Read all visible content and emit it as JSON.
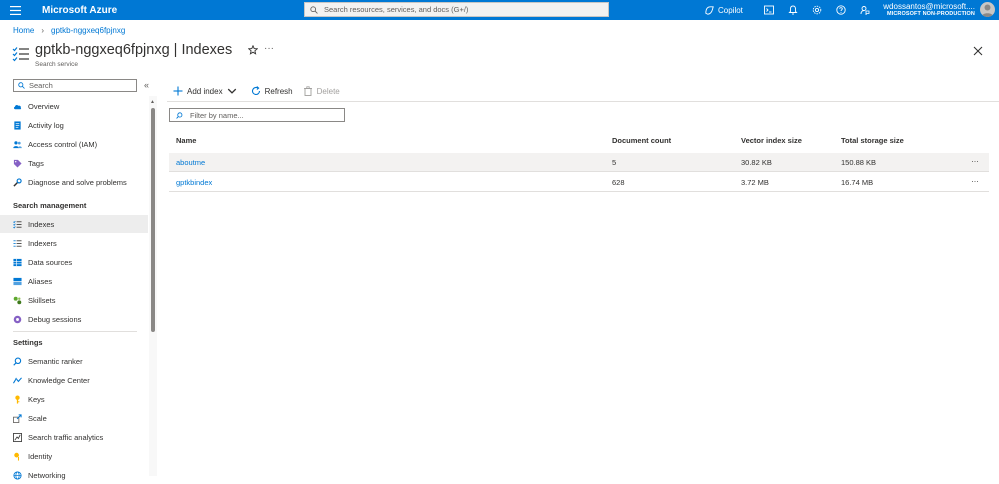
{
  "topbar": {
    "brand": "Microsoft Azure",
    "search_placeholder": "Search resources, services, and docs (G+/)",
    "copilot_label": "Copilot",
    "account_name": "wdossantos@microsoft....",
    "account_tenant": "MICROSOFT NON-PRODUCTION",
    "accent_color": "#0078d4"
  },
  "breadcrumb": {
    "home": "Home",
    "resource": "gptkb-nggxeq6fpjnxg"
  },
  "header": {
    "title": "gptkb-nggxeq6fpjnxg | Indexes",
    "subtitle": "Search service",
    "more": "···"
  },
  "sidebar": {
    "search_placeholder": "Search",
    "collapse": "«",
    "items_top": [
      {
        "label": "Overview",
        "icon": "cloud-icon"
      },
      {
        "label": "Activity log",
        "icon": "activity-log-icon"
      },
      {
        "label": "Access control (IAM)",
        "icon": "people-icon"
      },
      {
        "label": "Tags",
        "icon": "tag-icon"
      },
      {
        "label": "Diagnose and solve problems",
        "icon": "wrench-icon"
      }
    ],
    "section_search_management": "Search management",
    "items_search": [
      {
        "label": "Indexes",
        "icon": "list-icon"
      },
      {
        "label": "Indexers",
        "icon": "indexer-icon"
      },
      {
        "label": "Data sources",
        "icon": "database-icon"
      },
      {
        "label": "Aliases",
        "icon": "alias-icon"
      },
      {
        "label": "Skillsets",
        "icon": "skillset-icon"
      },
      {
        "label": "Debug sessions",
        "icon": "debug-icon"
      }
    ],
    "section_settings": "Settings",
    "items_settings": [
      {
        "label": "Semantic ranker",
        "icon": "search-icon"
      },
      {
        "label": "Knowledge Center",
        "icon": "knowledge-icon"
      },
      {
        "label": "Keys",
        "icon": "key-icon"
      },
      {
        "label": "Scale",
        "icon": "scale-icon"
      },
      {
        "label": "Search traffic analytics",
        "icon": "analytics-icon"
      },
      {
        "label": "Identity",
        "icon": "identity-icon"
      },
      {
        "label": "Networking",
        "icon": "networking-icon"
      }
    ]
  },
  "toolbar": {
    "add_index": "Add index",
    "refresh": "Refresh",
    "delete": "Delete"
  },
  "filter_placeholder": "Filter by name...",
  "table": {
    "columns": [
      "Name",
      "Document count",
      "Vector index size",
      "Total storage size"
    ],
    "rows": [
      {
        "name": "aboutme",
        "document_count": "5",
        "vector_index_size": "30.82 KB",
        "total_storage_size": "150.88 KB",
        "more": "···"
      },
      {
        "name": "gptkbindex",
        "document_count": "628",
        "vector_index_size": "3.72 MB",
        "total_storage_size": "16.74 MB",
        "more": "···"
      }
    ]
  }
}
